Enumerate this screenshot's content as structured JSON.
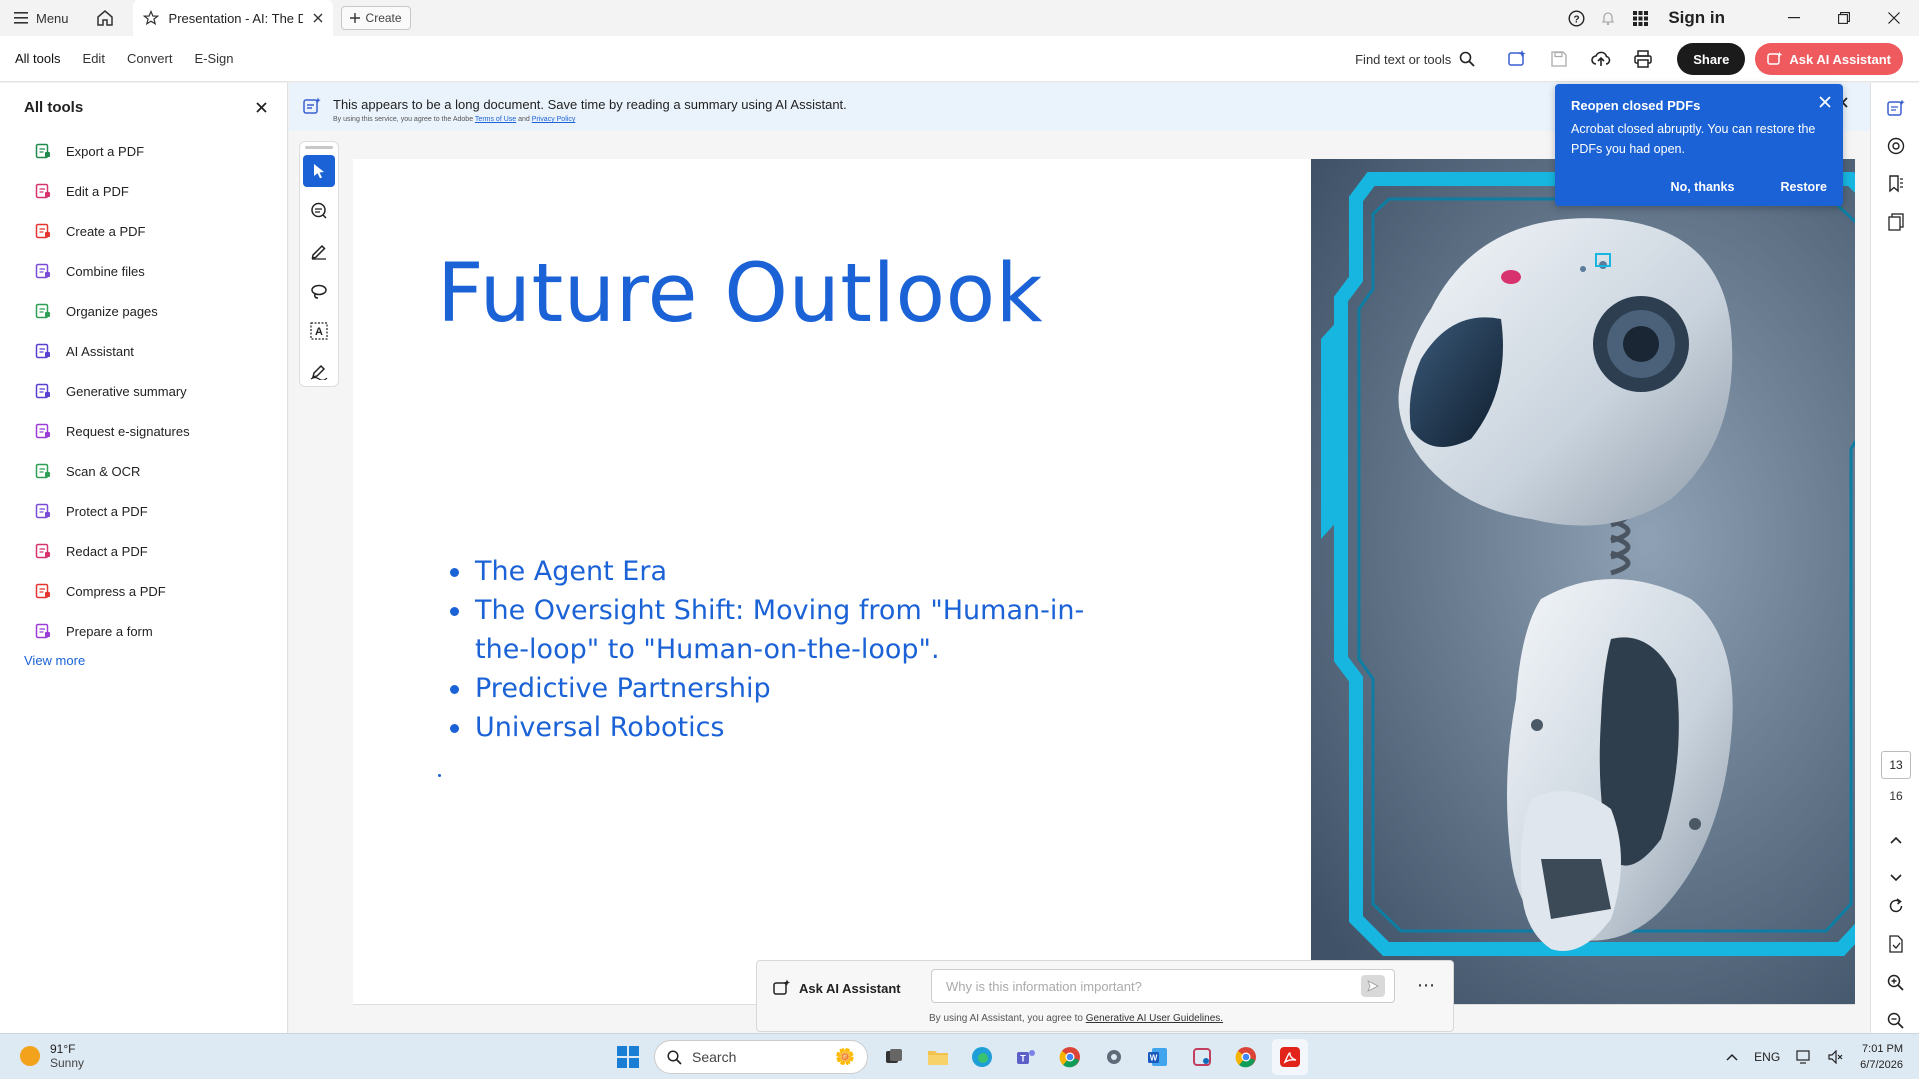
{
  "titlebar": {
    "menu_label": "Menu",
    "tab_title": "Presentation - AI: The D...",
    "create_label": "Create",
    "signin_label": "Sign in"
  },
  "toolbar": {
    "tabs": [
      "All tools",
      "Edit",
      "Convert",
      "E-Sign"
    ],
    "find_label": "Find text or tools",
    "share_label": "Share",
    "ai_label": "Ask AI Assistant"
  },
  "left_panel": {
    "title": "All tools",
    "items": [
      {
        "label": "Export a PDF",
        "icon": "export-pdf-icon",
        "color": "#1f8a4c"
      },
      {
        "label": "Edit a PDF",
        "icon": "edit-pdf-icon",
        "color": "#d8326e"
      },
      {
        "label": "Create a PDF",
        "icon": "create-pdf-icon",
        "color": "#e3342f"
      },
      {
        "label": "Combine files",
        "icon": "combine-files-icon",
        "color": "#7a4bd6"
      },
      {
        "label": "Organize pages",
        "icon": "organize-pages-icon",
        "color": "#2e9e52"
      },
      {
        "label": "AI Assistant",
        "icon": "ai-assistant-icon",
        "color": "#5a3fd0"
      },
      {
        "label": "Generative summary",
        "icon": "generative-summary-icon",
        "color": "#5a3fd0"
      },
      {
        "label": "Request e-signatures",
        "icon": "request-esignatures-icon",
        "color": "#9b3ad6"
      },
      {
        "label": "Scan & OCR",
        "icon": "scan-ocr-icon",
        "color": "#2e9e52"
      },
      {
        "label": "Protect a PDF",
        "icon": "protect-pdf-icon",
        "color": "#7a4bd6"
      },
      {
        "label": "Redact a PDF",
        "icon": "redact-pdf-icon",
        "color": "#d8326e"
      },
      {
        "label": "Compress a PDF",
        "icon": "compress-pdf-icon",
        "color": "#e3342f"
      },
      {
        "label": "Prepare a form",
        "icon": "prepare-form-icon",
        "color": "#9b3ad6"
      }
    ],
    "view_more": "View more"
  },
  "banner": {
    "text": "This appears to be a long document. Save time by reading a summary using AI Assistant.",
    "sub_prefix": "By using this service, you agree to the Adobe",
    "terms": "Terms of Use",
    "and": "and",
    "privacy": "Privacy Policy"
  },
  "slide": {
    "title": "Future Outlook",
    "bullets": [
      "The Agent Era",
      "The Oversight Shift: Moving from \"Human-in-the-loop\" to \"Human-on-the-loop\".",
      "Predictive Partnership",
      "Universal Robotics"
    ]
  },
  "toast": {
    "title": "Reopen closed PDFs",
    "message": "Acrobat closed abruptly. You can restore the PDFs you had open.",
    "dismiss": "No, thanks",
    "restore": "Restore"
  },
  "pagination": {
    "current": "13",
    "total": "16"
  },
  "ai_bar": {
    "label": "Ask AI Assistant",
    "placeholder": "Why is this information important?",
    "disclaimer_prefix": "By using AI Assistant, you agree to",
    "guidelines": "Generative AI User Guidelines."
  },
  "taskbar": {
    "temp": "91°F",
    "condition": "Sunny",
    "search": "Search",
    "lang": "ENG",
    "time": "7:01 PM",
    "date": "6/7/2026"
  },
  "colors": {
    "accent": "#1a62d6",
    "ai_button": "#ee5a5d",
    "robot_cyan": "#17b6e0"
  }
}
